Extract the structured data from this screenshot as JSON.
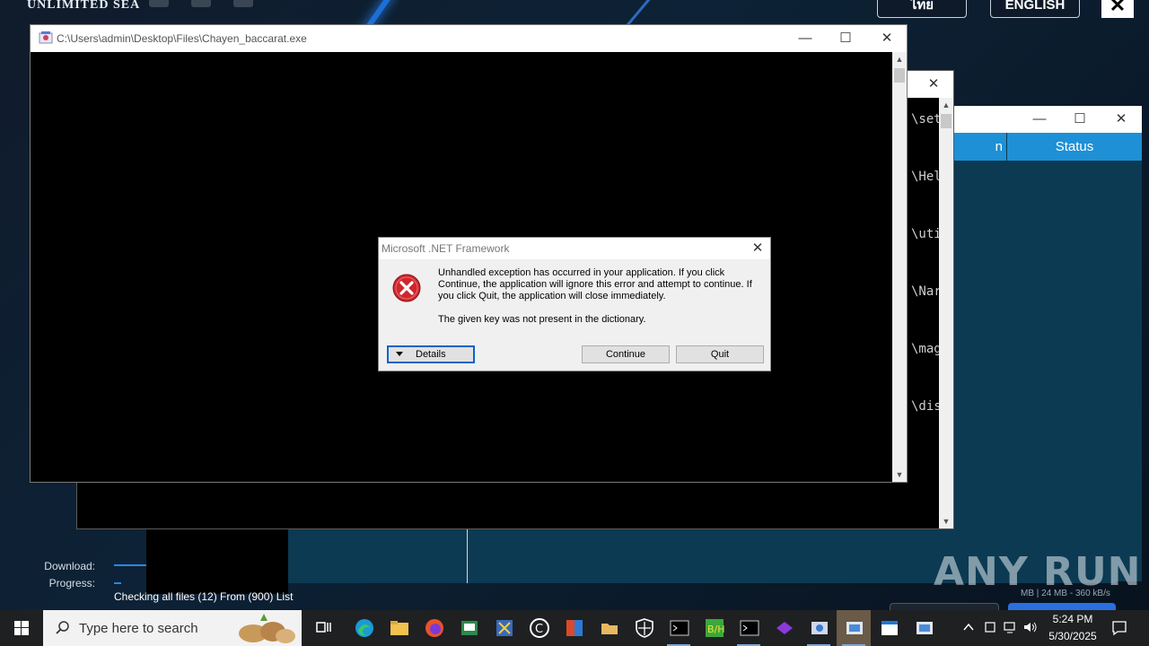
{
  "launcher": {
    "logo": "UNLIMITED SEA",
    "lang_thai": "ไทย",
    "lang_english": "ENGLISH",
    "close_glyph": "✕",
    "download_label": "Download:",
    "progress_label": "Progress:",
    "checking_text": "Checking all files (12) From (900) List",
    "speed_text": "MB | 24 MB - 360 kB/s",
    "download_progress": 0.04,
    "overall_progress": 0.01
  },
  "status_window": {
    "header_partial": "n",
    "header_status": "Status"
  },
  "console2": {
    "lines": [
      "\\set",
      "\\Hel",
      "\\uti",
      "\\Nar",
      "\\mag",
      "\\dis"
    ]
  },
  "console1": {
    "title": "C:\\Users\\admin\\Desktop\\Files\\Chayen_baccarat.exe"
  },
  "dialog": {
    "title": "Microsoft .NET Framework",
    "message": "Unhandled exception has occurred in your application. If you click Continue, the application will ignore this error and attempt to continue. If you click Quit, the application will close immediately.",
    "detail": "The given key was not present in the dictionary.",
    "details_button": "Details",
    "continue_button": "Continue",
    "quit_button": "Quit"
  },
  "watermark": "ANY RUN",
  "taskbar": {
    "search_placeholder": "Type here to search",
    "time": "5:24 PM",
    "date": "5/30/2025"
  },
  "caption": {
    "minimize": "—",
    "maximize": "☐",
    "close": "✕"
  }
}
